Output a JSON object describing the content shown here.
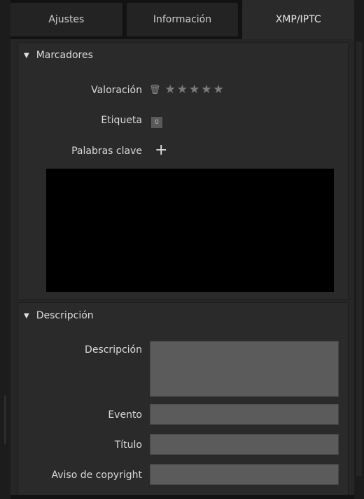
{
  "tabs": [
    {
      "label": "Ajustes"
    },
    {
      "label": "Información"
    },
    {
      "label": "XMP/IPTC"
    }
  ],
  "markers": {
    "title": "Marcadores",
    "rating_label": "Valoración",
    "rating_value": 0,
    "rating_max": 5,
    "label_label": "Etiqueta",
    "label_value": "0",
    "keywords_label": "Palabras clave",
    "keywords_add_icon": "plus-icon"
  },
  "description": {
    "title": "Descripción",
    "description_label": "Descripción",
    "description_value": "",
    "event_label": "Evento",
    "event_value": "",
    "title_label": "Título",
    "title_value": "",
    "copyright_label": "Aviso de copyright",
    "copyright_value": ""
  },
  "colors": {
    "panel_bg": "#2a2a2a",
    "field_bg": "#5b5b5b",
    "keywords_bg": "#000000",
    "star_color": "#7a7a7a"
  }
}
